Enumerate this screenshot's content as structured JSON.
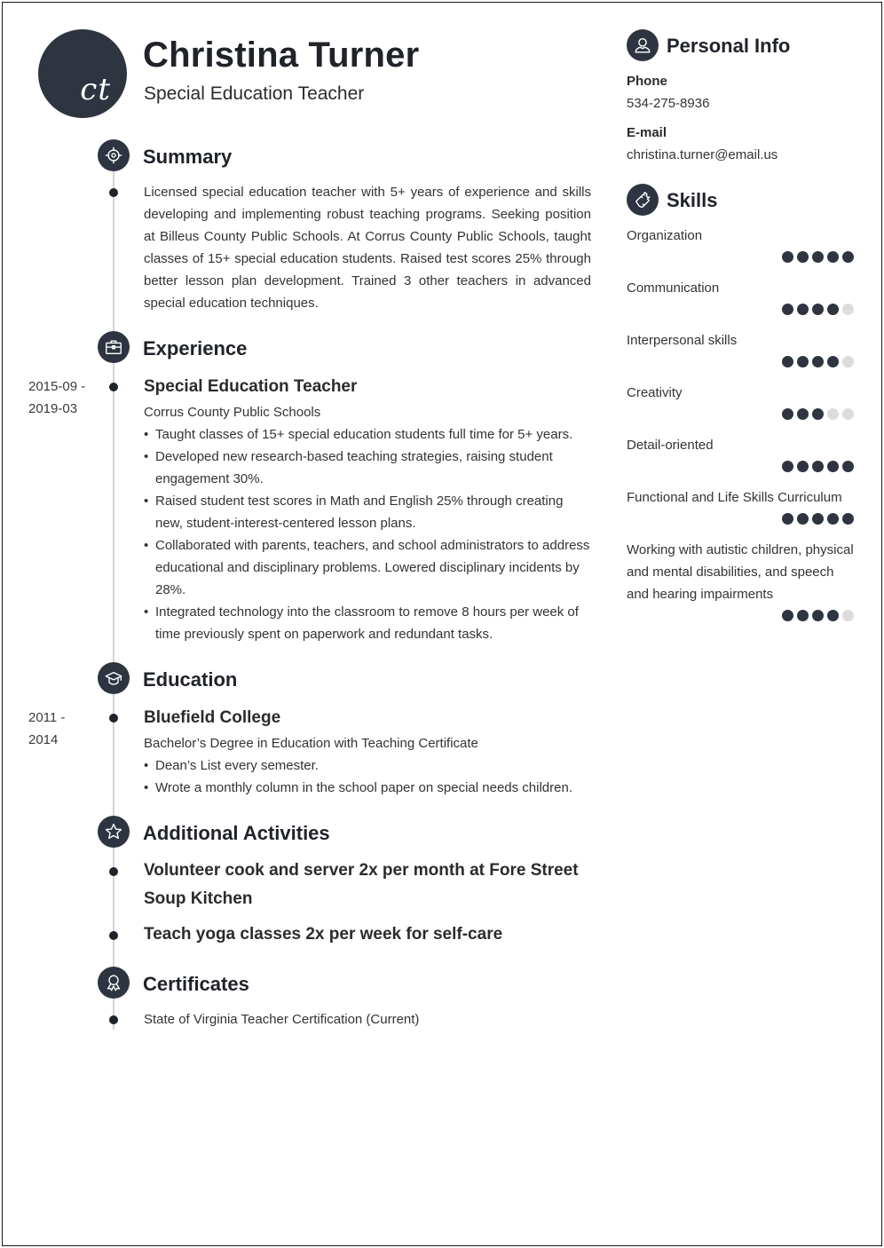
{
  "header": {
    "monogram": "ct",
    "name": "Christina Turner",
    "title": "Special Education Teacher"
  },
  "summary": {
    "heading": "Summary",
    "icon": "target-icon",
    "text": "Licensed special education teacher with 5+ years of experience and skills developing and implementing robust teaching programs. Seeking position at Billeus County Public Schools. At Corrus County Public Schools, taught classes of 15+ special education students. Raised test scores 25% through better lesson plan development. Trained 3 other teachers in advanced special education techniques."
  },
  "experience": {
    "heading": "Experience",
    "icon": "briefcase-icon",
    "items": [
      {
        "date_start": "2015-09 -",
        "date_end": "2019-03",
        "title": "Special Education Teacher",
        "org": "Corrus County Public Schools",
        "bullets": [
          "Taught classes of 15+ special education students full time for 5+ years.",
          "Developed new research-based teaching strategies, raising student engagement 30%.",
          "Raised student test scores in Math and English 25% through creating new, student-interest-centered lesson plans.",
          "Collaborated with parents, teachers, and school administrators to address educational and disciplinary problems. Lowered disciplinary incidents by 28%.",
          "Integrated technology into the classroom to remove 8 hours per week of time previously spent on paperwork and redundant tasks."
        ]
      }
    ]
  },
  "education": {
    "heading": "Education",
    "icon": "graduation-cap-icon",
    "items": [
      {
        "date_start": "2011 -",
        "date_end": "2014",
        "school": "Bluefield College",
        "degree": "Bachelor’s Degree in Education with Teaching Certificate",
        "bullets": [
          "Dean’s List every semester.",
          "Wrote a monthly column in the school paper on special needs children."
        ]
      }
    ]
  },
  "activities": {
    "heading": "Additional Activities",
    "icon": "star-icon",
    "items": [
      "Volunteer cook and server 2x per month at Fore Street Soup Kitchen",
      "Teach yoga classes 2x per week for self-care"
    ]
  },
  "certificates": {
    "heading": "Certificates",
    "icon": "award-ribbon-icon",
    "items": [
      "State of Virginia Teacher Certification (Current)"
    ]
  },
  "personal_info": {
    "heading": "Personal Info",
    "icon": "user-icon",
    "phone_label": "Phone",
    "phone": "534-275-8936",
    "email_label": "E-mail",
    "email": "christina.turner@email.us"
  },
  "skills": {
    "heading": "Skills",
    "icon": "puzzle-icon",
    "max_rating": 5,
    "items": [
      {
        "name": "Organization",
        "rating": 5
      },
      {
        "name": "Communication",
        "rating": 4
      },
      {
        "name": "Interpersonal skills",
        "rating": 4
      },
      {
        "name": "Creativity",
        "rating": 3
      },
      {
        "name": "Detail-oriented",
        "rating": 5
      },
      {
        "name": "Functional and Life Skills Curriculum",
        "rating": 5
      },
      {
        "name": "Working with autistic children, physical and mental disabilities, and speech and hearing impairments",
        "rating": 4
      }
    ]
  },
  "colors": {
    "accent": "#2e3440",
    "timeline": "#d4d4d4",
    "rating_off": "#dcdcdc"
  }
}
